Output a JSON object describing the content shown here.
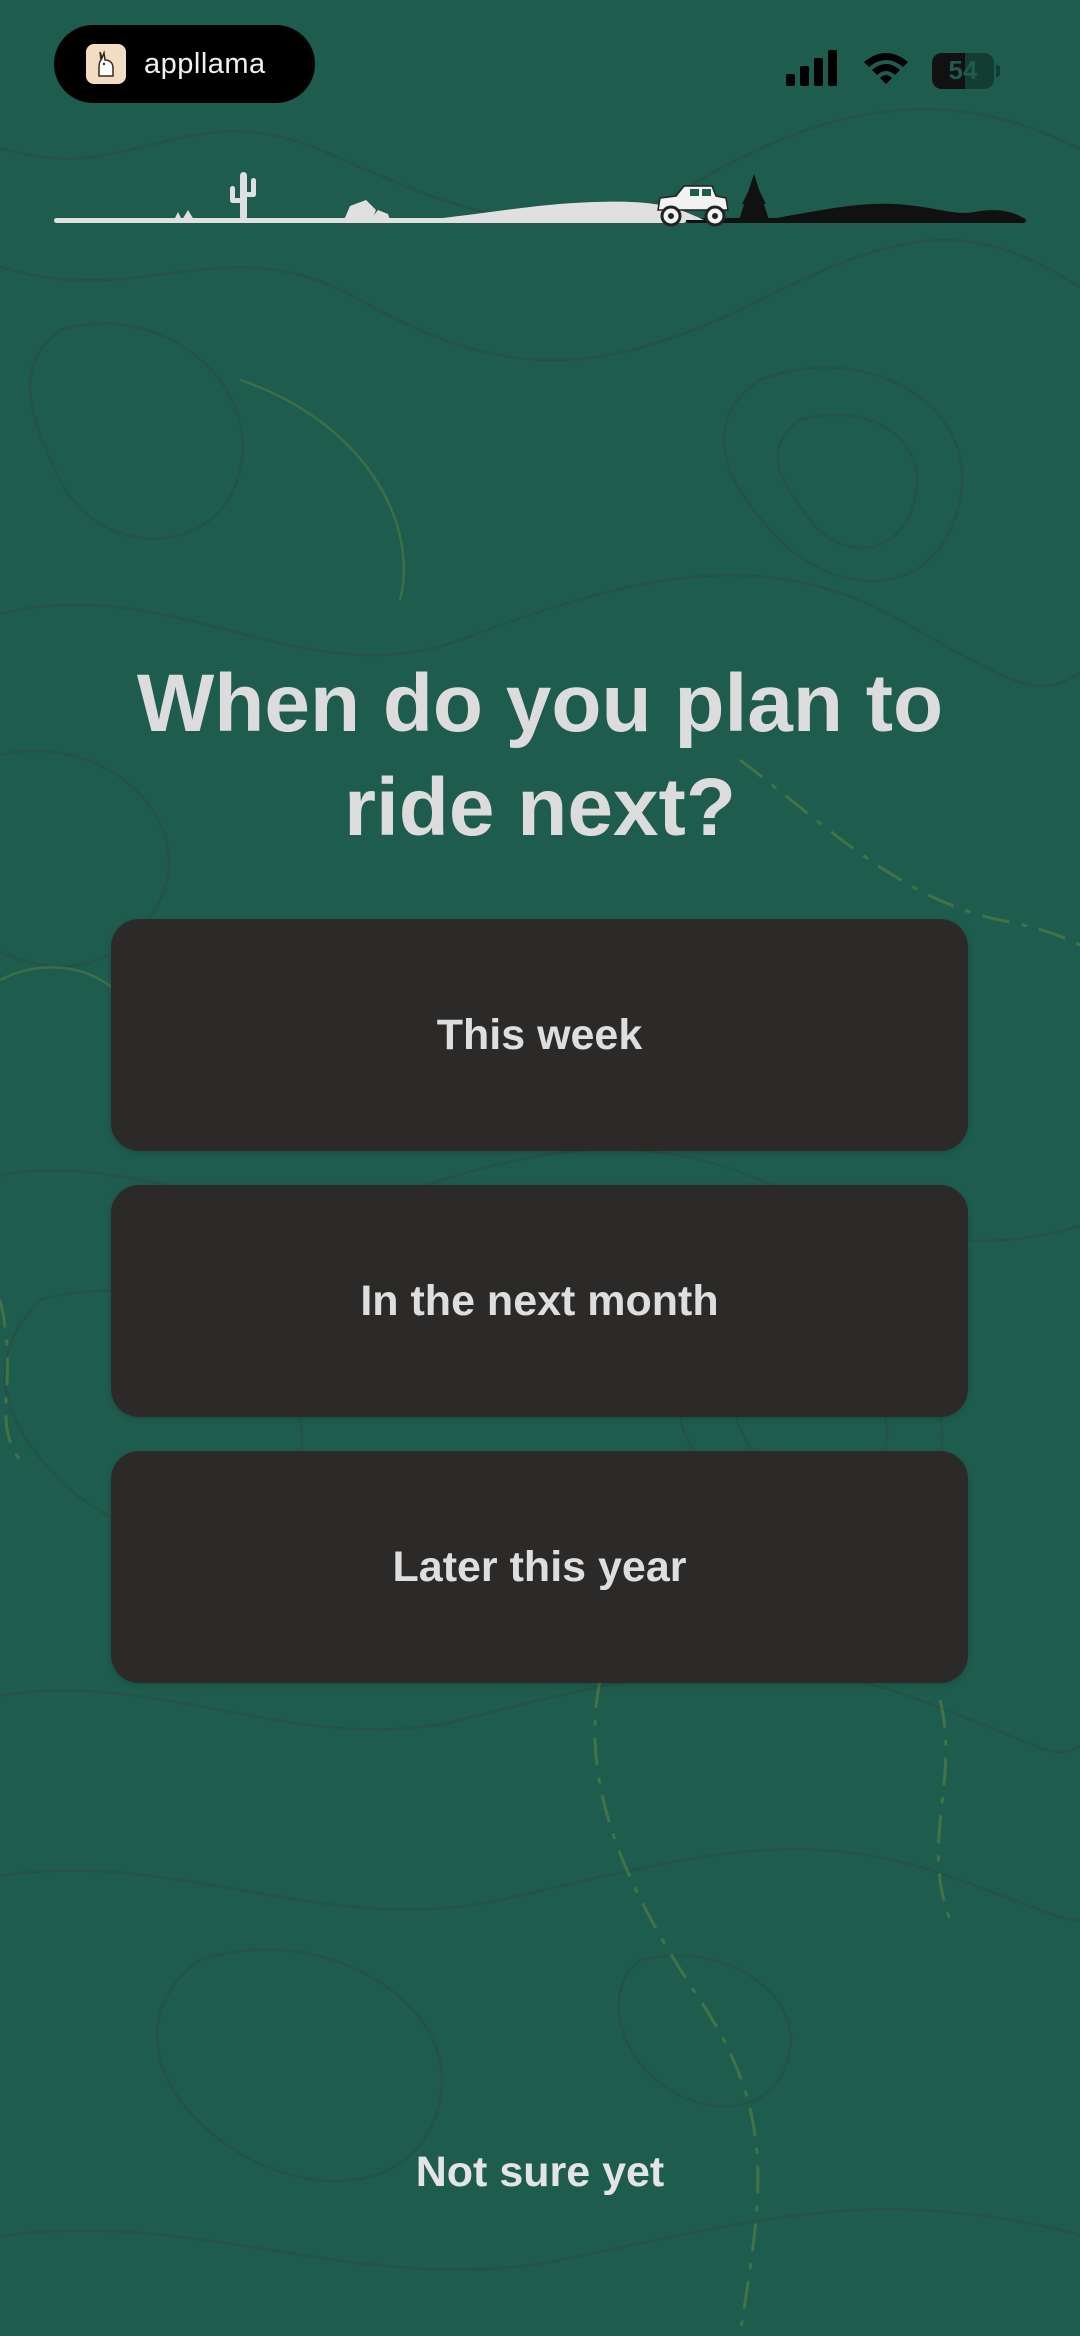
{
  "app": {
    "brand_name": "appllama",
    "brand_logo_icon": "llama-logo-icon"
  },
  "status_bar": {
    "battery_level": "54",
    "icons": [
      "cellular-signal-icon",
      "wifi-icon",
      "battery-icon"
    ]
  },
  "progress": {
    "scene_icons": [
      "cactus-icon",
      "rocks-icon",
      "offroad-vehicle-icon",
      "pine-tree-icon"
    ],
    "fraction_complete": 0.65
  },
  "question": {
    "title": "When do you plan to ride next?"
  },
  "options": [
    {
      "label": "This week"
    },
    {
      "label": "In the next month"
    },
    {
      "label": "Later this year"
    }
  ],
  "footer": {
    "skip_label": "Not sure yet"
  },
  "colors": {
    "background": "#1e5c4e",
    "button": "#2c2a28",
    "text": "#dcdcdc",
    "brand_pill": "#000000"
  }
}
